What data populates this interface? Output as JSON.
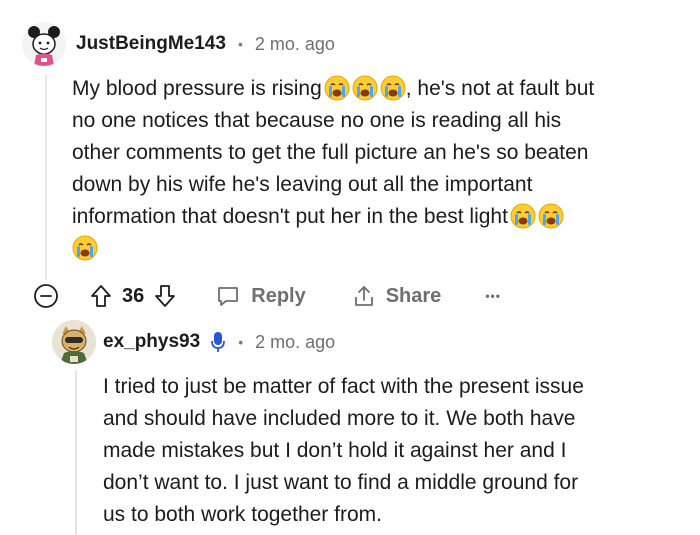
{
  "comments": [
    {
      "username": "JustBeingMe143",
      "time": "2 mo. ago",
      "lines": [
        "My blood pressure is rising",
        ", he's not at fault but",
        "no one notices that because no one is reading all his",
        "other comments to get the full picture an he's so beaten",
        "down by his wife he's leaving out all the important",
        "information that doesn't put her in the best light"
      ],
      "emoji": "loudly-crying-face",
      "votes": "36",
      "actions": {
        "reply": "Reply",
        "share": "Share",
        "more": "•••"
      }
    },
    {
      "username": "ex_phys93",
      "time": "2 mo. ago",
      "lines": [
        "I tried to just be matter of fact with the present issue",
        "and should have included more to it. We both have",
        "made mistakes but I don’t hold it against her and I",
        "don’t want to. I just want to find a middle ground for",
        "us to both work together from."
      ]
    }
  ],
  "colors": {
    "text": "#1c1c1c",
    "muted": "#6f6f6f",
    "mic": "#2a55d4",
    "thread": "#e6e6e6"
  }
}
